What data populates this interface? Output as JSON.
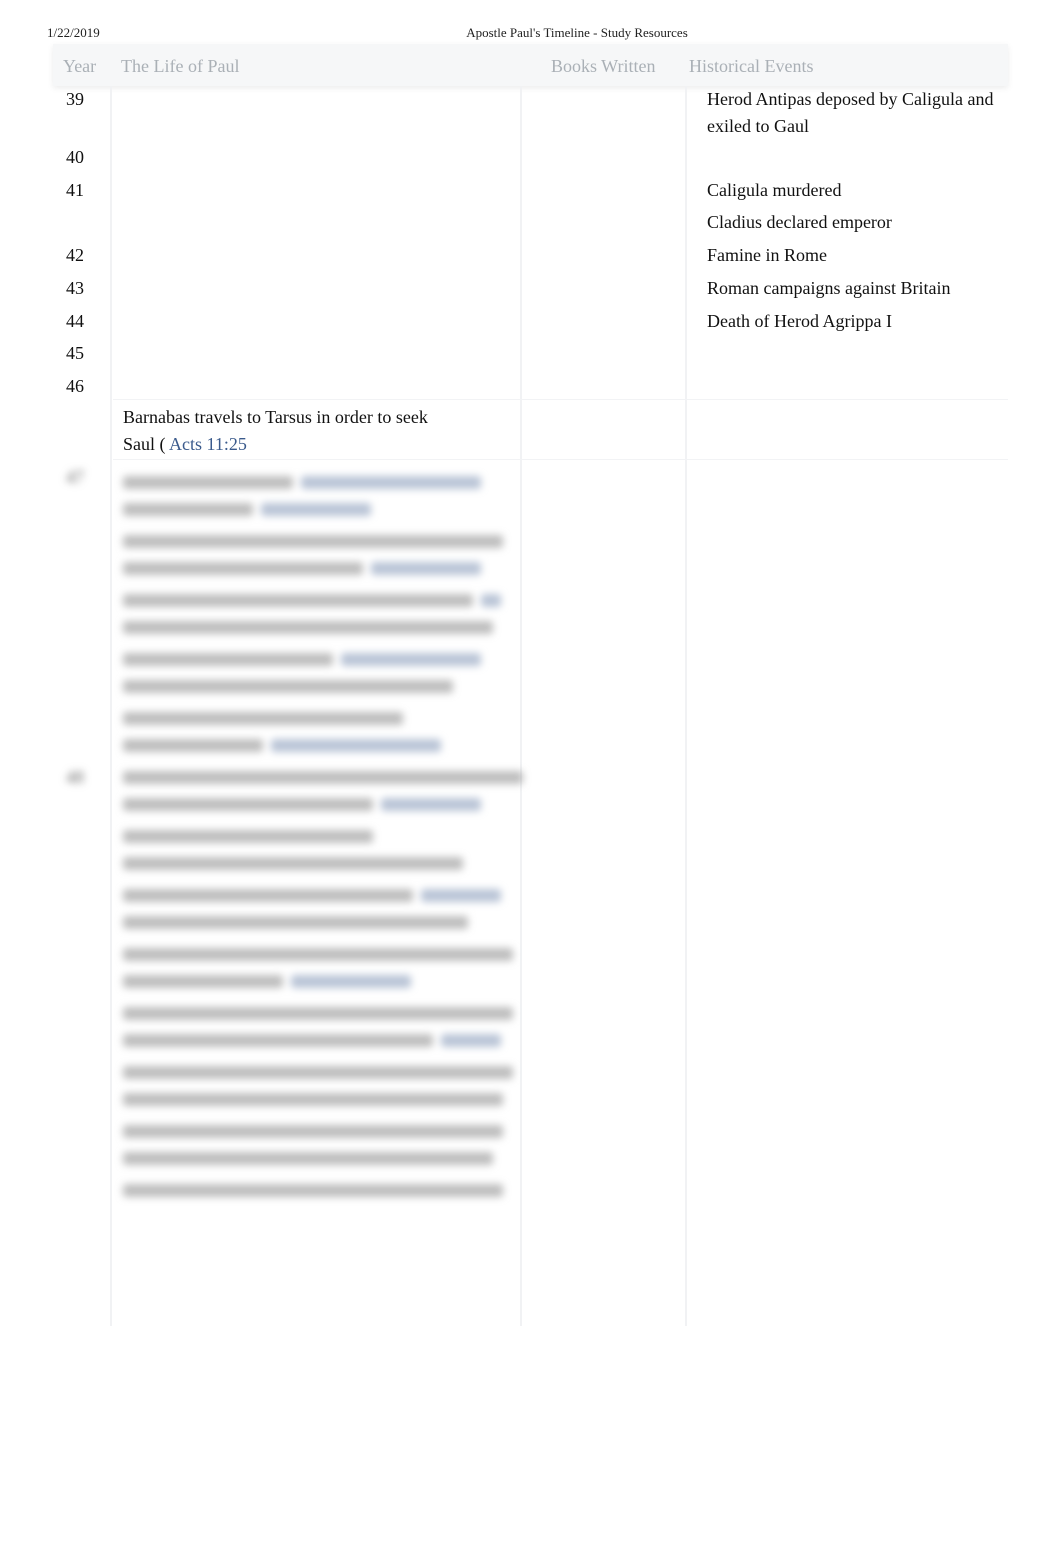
{
  "header": {
    "date": "1/22/2019",
    "title": "Apostle Paul's Timeline - Study Resources"
  },
  "table": {
    "columns": [
      "Year",
      "The Life of Paul",
      "Books Written",
      "Historical Events"
    ],
    "rows": [
      {
        "year": "39",
        "event": "Herod Antipas deposed by Caligula and exiled to Gaul"
      },
      {
        "year": "40",
        "event": ""
      },
      {
        "year": "41",
        "event": "Caligula murdered"
      },
      {
        "year": "",
        "event": "Cladius declared emperor"
      },
      {
        "year": "42",
        "event": "Famine in Rome"
      },
      {
        "year": "43",
        "event": "Roman campaigns against Britain"
      },
      {
        "year": "44",
        "event": "Death of Herod Agrippa I"
      },
      {
        "year": "45",
        "event": ""
      },
      {
        "year": "46",
        "event": ""
      }
    ],
    "life_entry": {
      "text": "Barnabas travels to Tarsus in order to seek Saul (",
      "ref": "Acts 11:25"
    },
    "blurred_years": [
      "47",
      "48"
    ]
  }
}
